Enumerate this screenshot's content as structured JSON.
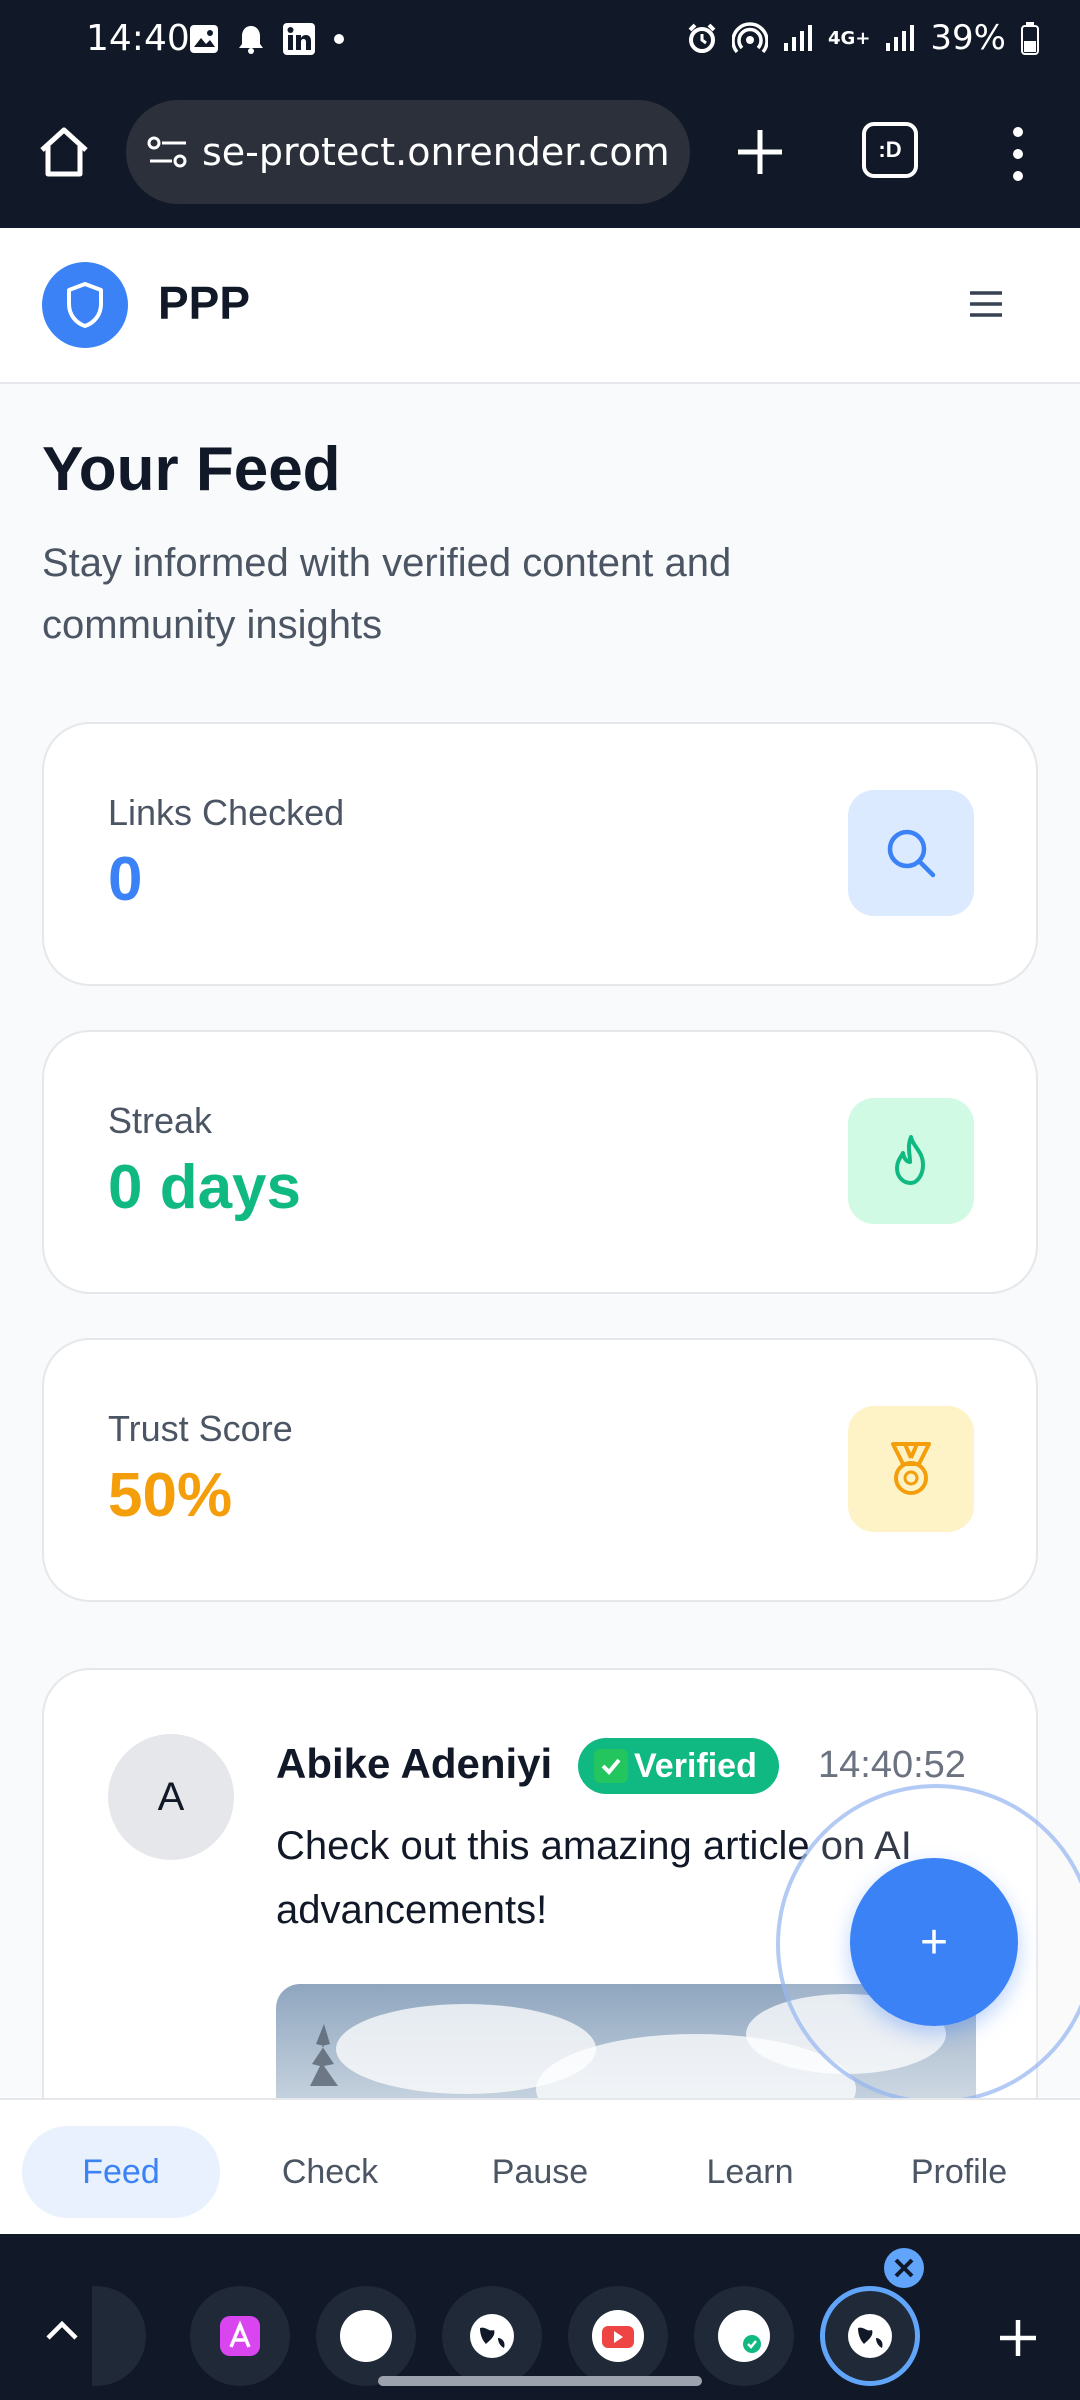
{
  "status_bar": {
    "time": "14:40",
    "battery": "39%",
    "network": "4G+"
  },
  "browser": {
    "url": "se-protect.onrender.com",
    "tabs_label": ":D"
  },
  "header": {
    "app_name": "PPP"
  },
  "main": {
    "title": "Your Feed",
    "subtitle": "Stay informed with verified content and community insights"
  },
  "stats": [
    {
      "label": "Links Checked",
      "value": "0",
      "color": "#3b82f6",
      "icon": "search-icon",
      "bg": "#dbeafe"
    },
    {
      "label": "Streak",
      "value": "0 days",
      "color": "#10b981",
      "icon": "flame-icon",
      "bg": "#d1fae5"
    },
    {
      "label": "Trust Score",
      "value": "50%",
      "color": "#f59e0b",
      "icon": "medal-icon",
      "bg": "#fef3c7"
    }
  ],
  "post": {
    "avatar_initial": "A",
    "author": "Abike Adeniyi",
    "badge": "Verified",
    "time": "14:40:52",
    "text": "Check out this amazing article on AI advancements!"
  },
  "fab": {
    "label": "+"
  },
  "bottom_nav": {
    "items": [
      {
        "label": "Feed",
        "active": true
      },
      {
        "label": "Check",
        "active": false
      },
      {
        "label": "Pause",
        "active": false
      },
      {
        "label": "Learn",
        "active": false
      },
      {
        "label": "Profile",
        "active": false
      }
    ]
  },
  "colors": {
    "accent": "#3b82f6",
    "success": "#10b981",
    "warning": "#f59e0b"
  }
}
